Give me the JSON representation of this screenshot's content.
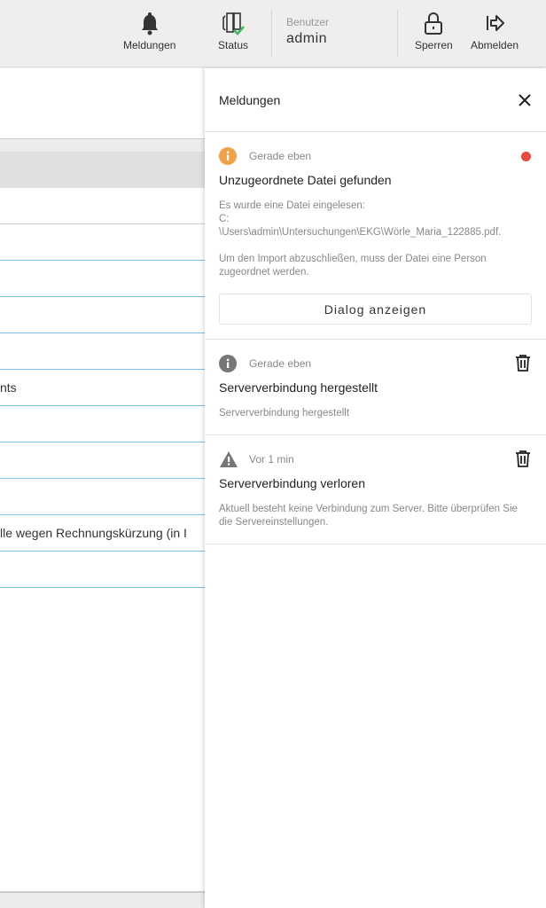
{
  "topbar": {
    "notifications_label": "Meldungen",
    "status_label": "Status",
    "user_label": "Benutzer",
    "user_name": "admin",
    "lock_label": "Sperren",
    "logout_label": "Abmelden"
  },
  "list": {
    "rows": [
      "",
      "",
      "",
      "",
      "",
      "nts",
      "",
      "",
      "",
      "lle wegen Rechnungskürzung (in I",
      ""
    ]
  },
  "panel": {
    "title": "Meldungen",
    "messages": [
      {
        "icon": "info-icon",
        "color": "#f0a24a",
        "time": "Gerade eben",
        "title": "Unzugeordnete Datei gefunden",
        "body1": "Es wurde eine Datei eingelesen:",
        "body2": "C:",
        "body3": "\\Users\\admin\\Untersuchungen\\EKG\\Wörle_Maria_122885.pdf.",
        "body4": "Um den Import abzuschließen, muss der Datei eine Person zugeordnet werden.",
        "button": "Dialog anzeigen",
        "unread": true
      },
      {
        "icon": "info-icon",
        "color": "#777777",
        "time": "Gerade eben",
        "title": "Serververbindung hergestellt",
        "body": "Serververbindung hergestellt"
      },
      {
        "icon": "warning-icon",
        "color": "#777777",
        "time": "Vor 1 min",
        "title": "Serververbindung verloren",
        "body": "Aktuell besteht keine Verbindung zum Server. Bitte überprüfen Sie die Servereinstellungen."
      }
    ]
  }
}
